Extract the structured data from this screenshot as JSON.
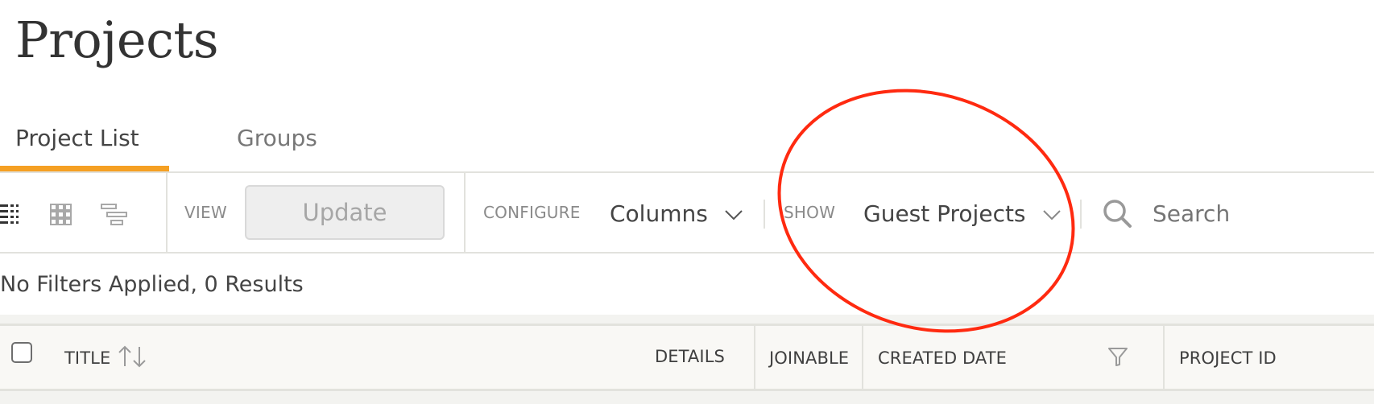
{
  "page": {
    "title": "Projects"
  },
  "tabs": [
    {
      "label": "Project List",
      "active": true
    },
    {
      "label": "Groups",
      "active": false
    }
  ],
  "toolbar": {
    "view_icons": [
      "list-view-icon",
      "grid-view-icon",
      "gantt-view-icon"
    ],
    "view_label": "VIEW",
    "update_label": "Update",
    "configure_label": "CONFIGURE",
    "columns_label": "Columns",
    "show_label": "SHOW",
    "show_selected": "Guest Projects",
    "search_placeholder": "Search"
  },
  "results": {
    "summary": "No Filters Applied, 0 Results"
  },
  "table": {
    "columns": [
      {
        "label": "TITLE",
        "sortable": true
      },
      {
        "label": "DETAILS"
      },
      {
        "label": "JOINABLE"
      },
      {
        "label": "CREATED DATE",
        "filterable": true
      },
      {
        "label": "PROJECT ID"
      }
    ],
    "rows": []
  },
  "colors": {
    "accent": "#f5a023",
    "annotation": "#ff2a10",
    "header_bg": "#f9f8f5",
    "border": "#e2e2dd"
  }
}
